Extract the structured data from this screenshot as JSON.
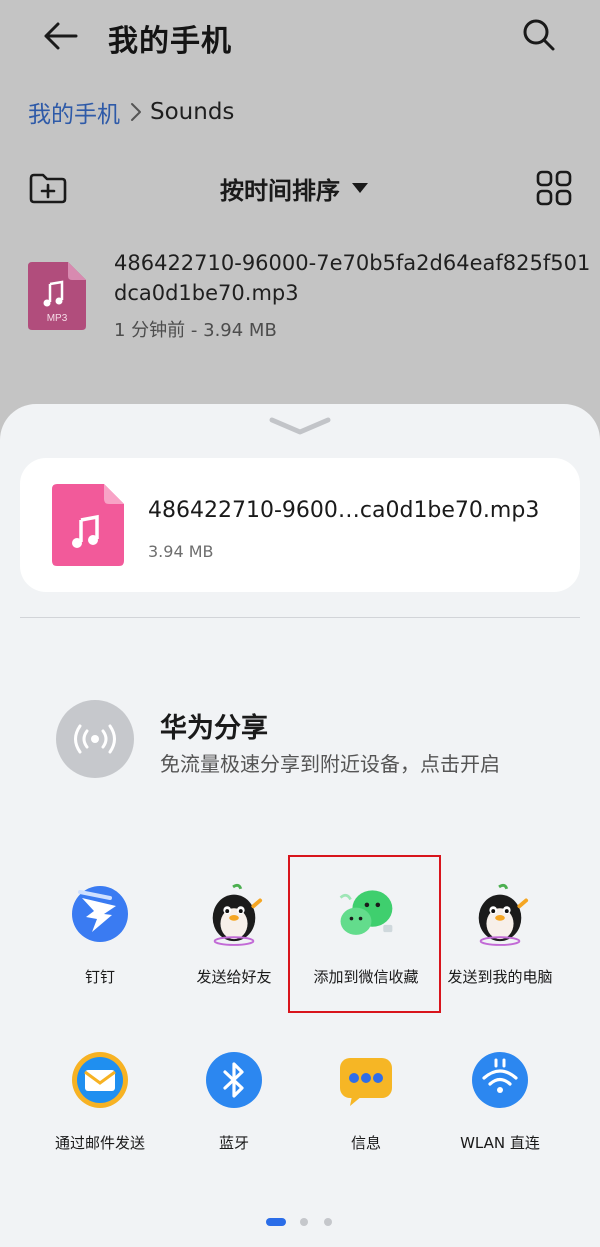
{
  "header": {
    "title": "我的手机",
    "back_icon": "arrow-left-icon",
    "search_icon": "search-icon"
  },
  "breadcrumb": {
    "root": "我的手机",
    "separator_icon": "chevron-right-icon",
    "current": "Sounds"
  },
  "toolbar": {
    "new_folder_icon": "folder-add-icon",
    "sort_label": "按时间排序",
    "view_icon": "grid-view-icon"
  },
  "file": {
    "name": "486422710-96000-7e70b5fa2d64eaf825f501dca0d1be70.mp3",
    "icon_badge": "MP3",
    "meta": "1 分钟前 - 3.94 MB"
  },
  "share_sheet": {
    "file_card": {
      "name": "486422710-9600…ca0d1be70.mp3",
      "size": "3.94 MB"
    },
    "huawei_share": {
      "title": "华为分享",
      "subtitle": "免流量极速分享到附近设备，点击开启"
    },
    "apps": [
      {
        "label": "钉钉",
        "icon": "dingtalk-icon"
      },
      {
        "label": "发送给好友",
        "icon": "qq-penguin-icon"
      },
      {
        "label": "添加到微信收藏",
        "icon": "wechat-favorites-icon"
      },
      {
        "label": "发送到我的电脑",
        "icon": "qq-penguin-icon"
      },
      {
        "label": "通过邮件发送",
        "icon": "email-icon"
      },
      {
        "label": "蓝牙",
        "icon": "bluetooth-icon"
      },
      {
        "label": "信息",
        "icon": "messages-icon"
      },
      {
        "label": "WLAN 直连",
        "icon": "wlan-direct-icon"
      }
    ],
    "page_count": 3,
    "active_page": 1
  },
  "colors": {
    "accent": "#2b6de8",
    "highlight_box": "#d8141c",
    "music_pink": "#f25a9a"
  }
}
